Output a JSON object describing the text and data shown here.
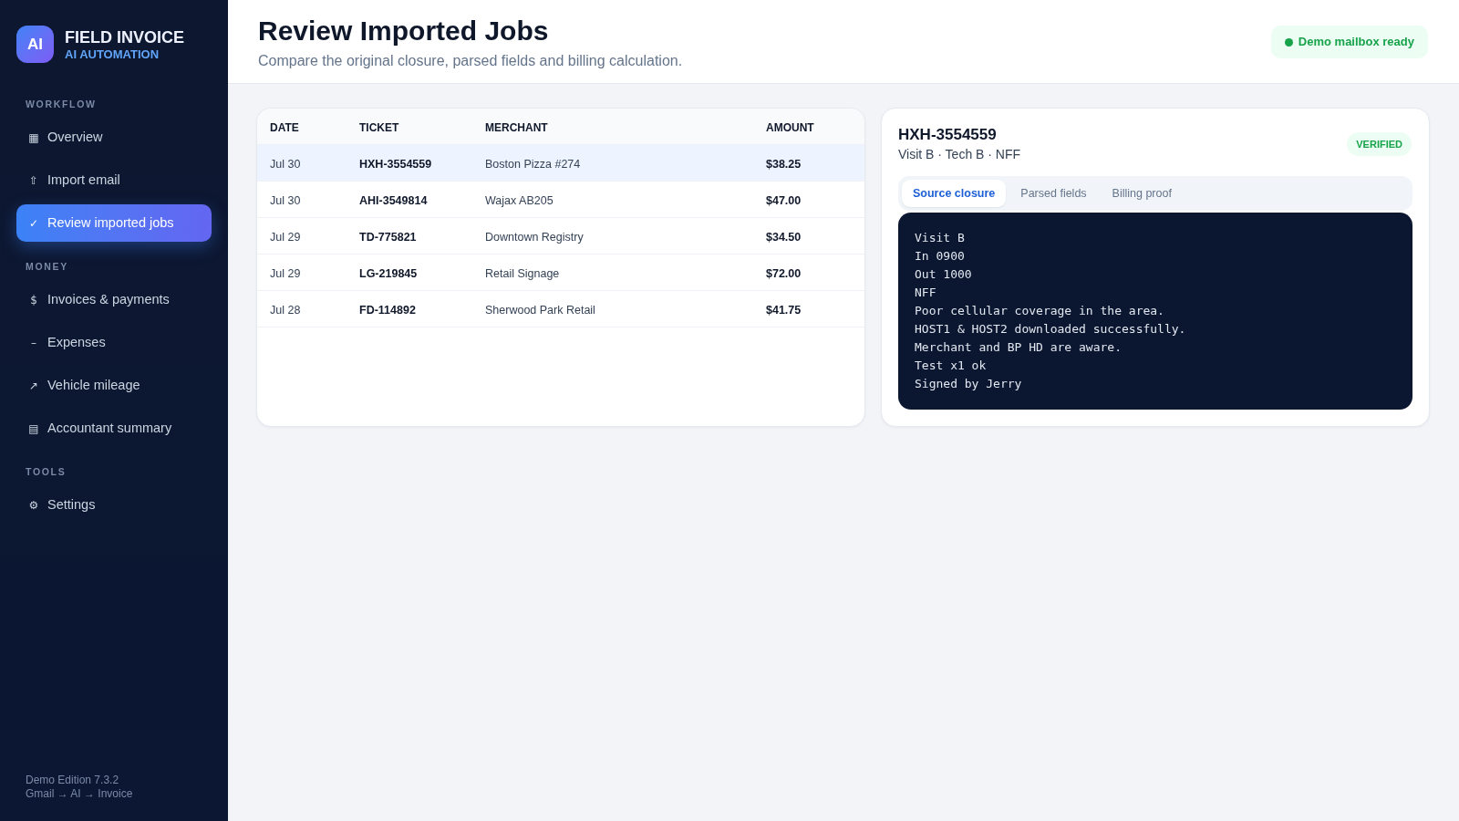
{
  "sidebar": {
    "brand": {
      "logo": "AI",
      "name": "FIELD INVOICE",
      "tagline": "AI AUTOMATION"
    },
    "sections": [
      {
        "label": "WORKFLOW",
        "items": [
          {
            "icon": "▦",
            "label": "Overview",
            "selected": false
          },
          {
            "icon": "⇧",
            "label": "Import email",
            "selected": false
          },
          {
            "icon": "✓",
            "label": "Review imported jobs",
            "selected": true
          }
        ]
      },
      {
        "label": "MONEY",
        "items": [
          {
            "icon": "$",
            "label": "Invoices & payments",
            "selected": false
          },
          {
            "icon": "–",
            "label": "Expenses",
            "selected": false
          },
          {
            "icon": "↗",
            "label": "Vehicle mileage",
            "selected": false
          },
          {
            "icon": "▤",
            "label": "Accountant summary",
            "selected": false
          }
        ]
      },
      {
        "label": "TOOLS",
        "items": [
          {
            "icon": "⚙",
            "label": "Settings",
            "selected": false
          }
        ]
      }
    ],
    "footer": [
      "Demo Edition 7.3.2",
      "Gmail → AI → Invoice"
    ]
  },
  "header": {
    "title": "Review Imported Jobs",
    "subtitle": "Compare the original closure, parsed fields and billing calculation.",
    "status": "Demo mailbox ready"
  },
  "jobs_table": {
    "columns": [
      "DATE",
      "TICKET",
      "MERCHANT",
      "AMOUNT"
    ],
    "rows": [
      {
        "date": "Jul 30",
        "ticket": "HXH-3554559",
        "merchant": "Boston Pizza #274",
        "amount": "$38.25",
        "selected": true
      },
      {
        "date": "Jul 30",
        "ticket": "AHI-3549814",
        "merchant": "Wajax AB205",
        "amount": "$47.00",
        "selected": false
      },
      {
        "date": "Jul 29",
        "ticket": "TD-775821",
        "merchant": "Downtown Registry",
        "amount": "$34.50",
        "selected": false
      },
      {
        "date": "Jul 29",
        "ticket": "LG-219845",
        "merchant": "Retail Signage",
        "amount": "$72.00",
        "selected": false
      },
      {
        "date": "Jul 28",
        "ticket": "FD-114892",
        "merchant": "Sherwood Park Retail",
        "amount": "$41.75",
        "selected": false
      }
    ]
  },
  "detail": {
    "title": "HXH-3554559",
    "subtitle": "Visit B · Tech B · NFF",
    "badge": "VERIFIED",
    "tabs": [
      {
        "label": "Source closure",
        "selected": true
      },
      {
        "label": "Parsed fields",
        "selected": false
      },
      {
        "label": "Billing proof",
        "selected": false
      }
    ],
    "closure_text": "Visit B\nIn 0900\nOut 1000\nNFF\nPoor cellular coverage in the area.\nHOST1 & HOST2 downloaded successfully.\nMerchant and BP HD are aware.\nTest x1 ok\nSigned by Jerry"
  }
}
